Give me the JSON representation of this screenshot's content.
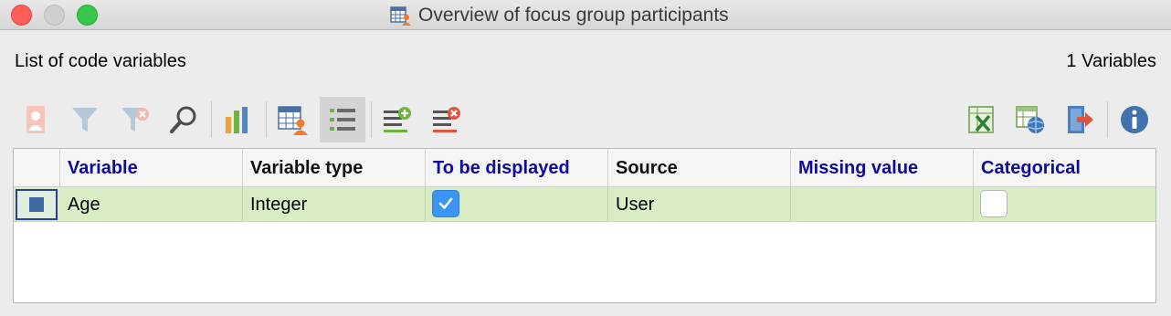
{
  "window": {
    "title": "Overview of focus group participants"
  },
  "header": {
    "list_label": "List of code variables",
    "count": "1 Variables"
  },
  "toolbar": {
    "buttons": [
      {
        "name": "activate-cases-icon",
        "enabled": false
      },
      {
        "name": "filter-icon",
        "enabled": false
      },
      {
        "name": "clear-filter-icon",
        "enabled": false
      },
      {
        "name": "search-icon",
        "enabled": true
      },
      {
        "name": "bar-chart-icon",
        "enabled": true
      },
      {
        "name": "data-editor-icon",
        "enabled": true
      },
      {
        "name": "variable-list-icon",
        "enabled": true,
        "active": true
      },
      {
        "name": "add-variable-icon",
        "enabled": true
      },
      {
        "name": "delete-variable-icon",
        "enabled": true
      },
      {
        "name": "excel-export-icon",
        "enabled": true
      },
      {
        "name": "web-export-icon",
        "enabled": true
      },
      {
        "name": "export-icon",
        "enabled": true
      },
      {
        "name": "info-icon",
        "enabled": true
      }
    ]
  },
  "table": {
    "columns": [
      "Variable",
      "Variable type",
      "To be displayed",
      "Source",
      "Missing value",
      "Categorical"
    ],
    "rows": [
      {
        "variable": "Age",
        "type": "Integer",
        "displayed": true,
        "source": "User",
        "missing": "",
        "categorical": false
      }
    ]
  },
  "colors": {
    "header_blue": "#10099d",
    "row_green": "#d9ecc4",
    "checkbox_blue": "#3b95f5"
  }
}
